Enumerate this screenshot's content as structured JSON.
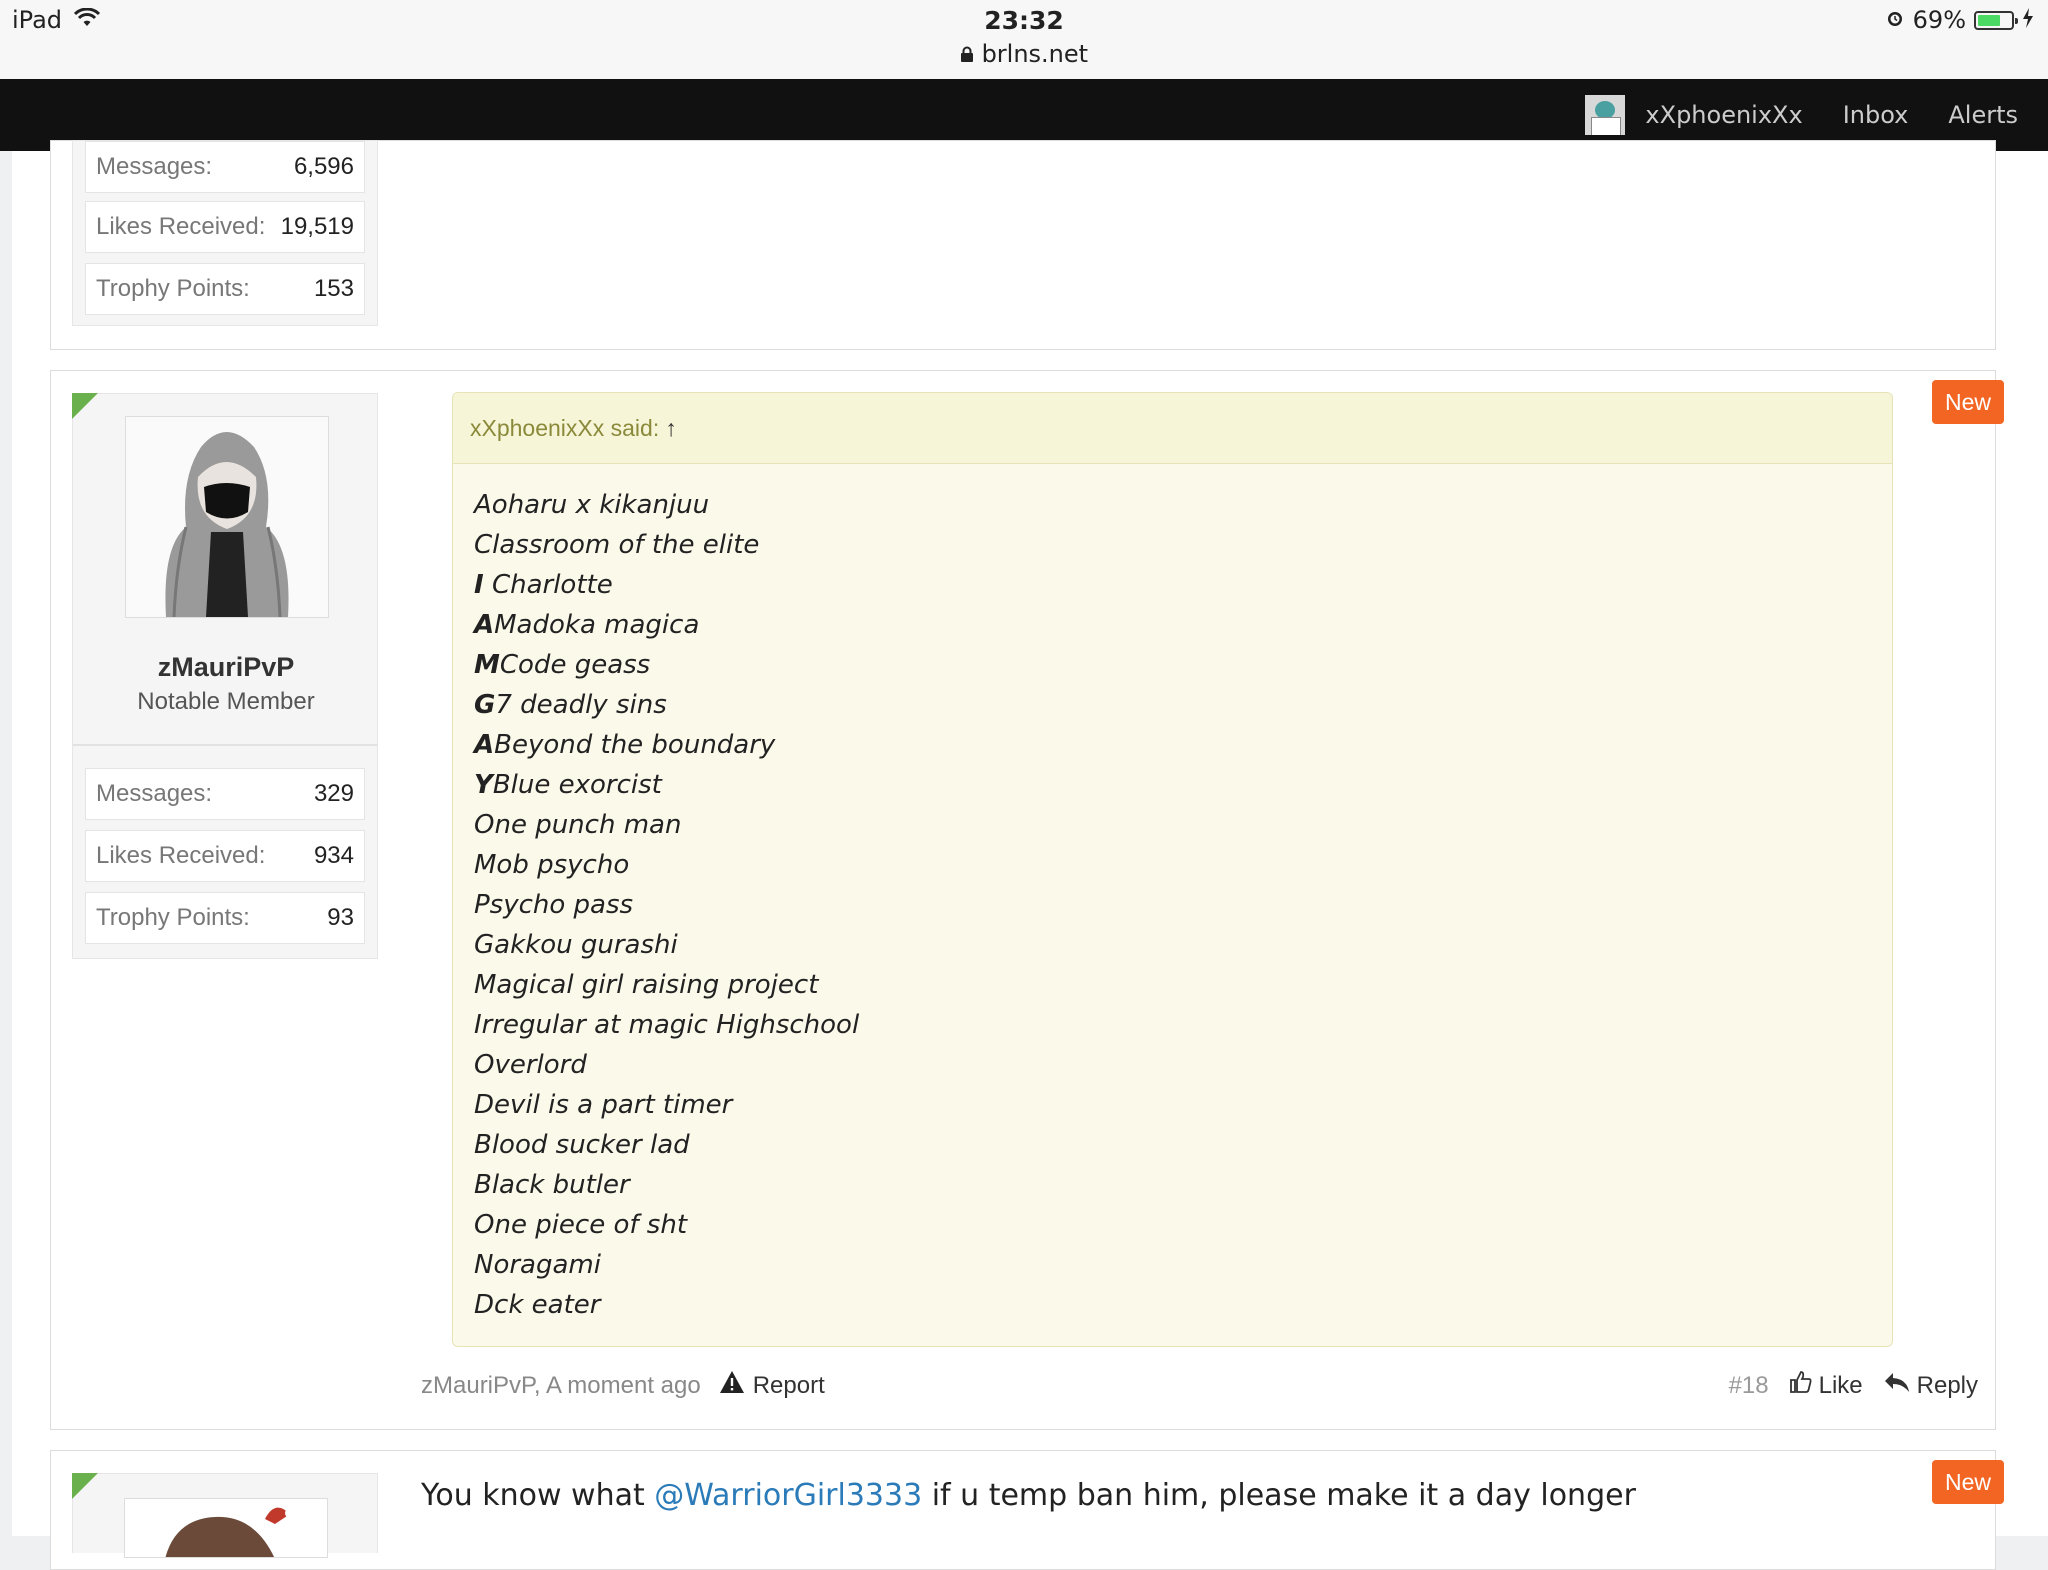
{
  "status_bar": {
    "device": "iPad",
    "time": "23:32",
    "url": "brlns.net",
    "battery": "69%",
    "battery_level": 0.69
  },
  "nav": {
    "username": "xXphoenixXx",
    "inbox": "Inbox",
    "alerts": "Alerts"
  },
  "prev_post": {
    "stats": [
      {
        "label": "Messages:",
        "value": "6,596"
      },
      {
        "label": "Likes Received:",
        "value": "19,519"
      },
      {
        "label": "Trophy Points:",
        "value": "153"
      }
    ]
  },
  "post": {
    "username": "zMauriPvP",
    "user_title": "Notable Member",
    "stats": [
      {
        "label": "Messages:",
        "value": "329"
      },
      {
        "label": "Likes Received:",
        "value": "934"
      },
      {
        "label": "Trophy Points:",
        "value": "93"
      }
    ],
    "new_badge": "New",
    "quote_header": "xXphoenixXx said:",
    "quote_arrow": "↑",
    "quote_lines": [
      {
        "prefix": "",
        "text": "Aoharu x kikanjuu"
      },
      {
        "prefix": "",
        "text": "Classroom of the elite"
      },
      {
        "prefix": "I",
        "text": " Charlotte"
      },
      {
        "prefix": "A",
        "text": "Madoka magica"
      },
      {
        "prefix": "M",
        "text": "Code geass"
      },
      {
        "prefix": "G",
        "text": "7 deadly sins"
      },
      {
        "prefix": "A",
        "text": "Beyond the boundary"
      },
      {
        "prefix": "Y",
        "text": "Blue exorcist"
      },
      {
        "prefix": "",
        "text": "One punch man"
      },
      {
        "prefix": "",
        "text": "Mob psycho"
      },
      {
        "prefix": "",
        "text": "Psycho pass"
      },
      {
        "prefix": "",
        "text": "Gakkou gurashi"
      },
      {
        "prefix": "",
        "text": "Magical girl raising project"
      },
      {
        "prefix": "",
        "text": "Irregular at magic Highschool"
      },
      {
        "prefix": "",
        "text": "Overlord"
      },
      {
        "prefix": "",
        "text": "Devil is a part timer"
      },
      {
        "prefix": "",
        "text": "Blood sucker lad"
      },
      {
        "prefix": "",
        "text": "Black butler"
      },
      {
        "prefix": "",
        "text": "One piece of sht"
      },
      {
        "prefix": "",
        "text": "Noragami"
      },
      {
        "prefix": "",
        "text": "Dck eater"
      }
    ],
    "meta": "zMauriPvP, A moment ago",
    "report": "Report",
    "post_number": "#18",
    "like": "Like",
    "reply": "Reply"
  },
  "next_post": {
    "new_badge": "New",
    "text_before": "You know what ",
    "mention": "@WarriorGirl3333",
    "text_after": " if u temp ban him, please make it a day longer"
  },
  "colors": {
    "accent": "#f26522",
    "corner": "#6ab04c",
    "quote_bg": "#fbf9ea",
    "nav_bg": "#111111"
  }
}
